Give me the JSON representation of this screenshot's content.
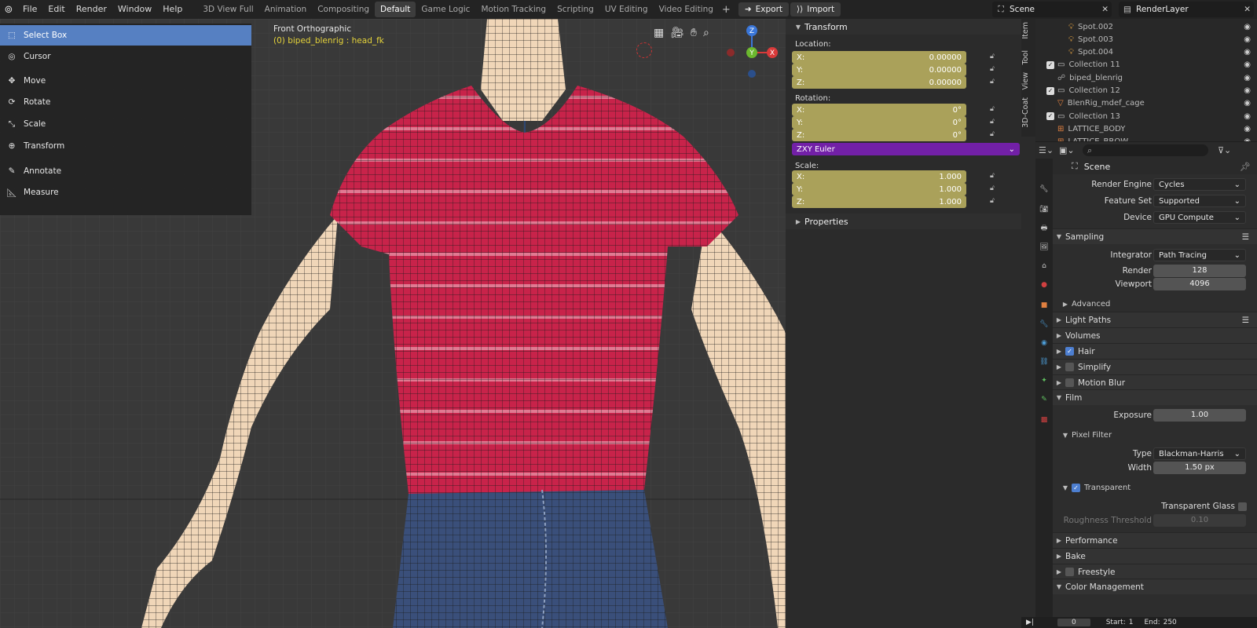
{
  "menu": [
    "File",
    "Edit",
    "Render",
    "Window",
    "Help"
  ],
  "workspaces": [
    "3D View Full",
    "Animation",
    "Compositing",
    "Default",
    "Game Logic",
    "Motion Tracking",
    "Scripting",
    "UV Editing",
    "Video Editing"
  ],
  "active_workspace": "Default",
  "export_label": "Export",
  "import_label": "Import",
  "scene_name": "Scene",
  "render_layer": "RenderLayer",
  "viewport": {
    "title": "Front Orthographic",
    "subtitle": "(0) biped_blenrig : head_fk",
    "tools": [
      {
        "label": "Select Box",
        "icon": "select-box-icon"
      },
      {
        "label": "Cursor",
        "icon": "cursor-icon"
      },
      {
        "label": "Move",
        "icon": "move-icon"
      },
      {
        "label": "Rotate",
        "icon": "rotate-icon"
      },
      {
        "label": "Scale",
        "icon": "scale-icon"
      },
      {
        "label": "Transform",
        "icon": "transform-icon"
      },
      {
        "label": "Annotate",
        "icon": "annotate-icon"
      },
      {
        "label": "Measure",
        "icon": "measure-icon"
      }
    ],
    "gizmo": {
      "z": "Z",
      "y": "Y",
      "x": "X"
    }
  },
  "transform": {
    "header": "Transform",
    "location_label": "Location:",
    "location": [
      {
        "axis": "X:",
        "value": "0.00000"
      },
      {
        "axis": "Y:",
        "value": "0.00000"
      },
      {
        "axis": "Z:",
        "value": "0.00000"
      }
    ],
    "rotation_label": "Rotation:",
    "rotation": [
      {
        "axis": "X:",
        "value": "0°"
      },
      {
        "axis": "Y:",
        "value": "0°"
      },
      {
        "axis": "Z:",
        "value": "0°"
      }
    ],
    "rotation_mode": "ZXY Euler",
    "scale_label": "Scale:",
    "scale": [
      {
        "axis": "X:",
        "value": "1.000"
      },
      {
        "axis": "Y:",
        "value": "1.000"
      },
      {
        "axis": "Z:",
        "value": "1.000"
      }
    ],
    "properties_header": "Properties"
  },
  "side_tabs": [
    "Item",
    "Tool",
    "View",
    "3D-Coat"
  ],
  "outliner": [
    {
      "name": "Spot.002",
      "indent": 3,
      "type": "light"
    },
    {
      "name": "Spot.003",
      "indent": 3,
      "type": "light"
    },
    {
      "name": "Spot.004",
      "indent": 3,
      "type": "light"
    },
    {
      "name": "Collection 11",
      "indent": 1,
      "type": "collection"
    },
    {
      "name": "biped_blenrig",
      "indent": 2,
      "type": "armature"
    },
    {
      "name": "Collection 12",
      "indent": 1,
      "type": "collection"
    },
    {
      "name": "BlenRig_mdef_cage",
      "indent": 2,
      "type": "mesh"
    },
    {
      "name": "Collection 13",
      "indent": 1,
      "type": "collection"
    },
    {
      "name": "LATTICE_BODY",
      "indent": 2,
      "type": "lattice"
    },
    {
      "name": "LATTICE_BROW",
      "indent": 2,
      "type": "lattice"
    }
  ],
  "properties": {
    "context": "Scene",
    "render_engine_label": "Render Engine",
    "render_engine": "Cycles",
    "feature_set_label": "Feature Set",
    "feature_set": "Supported",
    "device_label": "Device",
    "device": "GPU Compute",
    "sampling": "Sampling",
    "integrator_label": "Integrator",
    "integrator": "Path Tracing",
    "render_label": "Render",
    "render_samples": "128",
    "viewport_label": "Viewport",
    "viewport_samples": "4096",
    "advanced": "Advanced",
    "light_paths": "Light Paths",
    "volumes": "Volumes",
    "hair": "Hair",
    "simplify": "Simplify",
    "motion_blur": "Motion Blur",
    "film": "Film",
    "exposure_label": "Exposure",
    "exposure": "1.00",
    "pixel_filter": "Pixel Filter",
    "type_label": "Type",
    "filter_type": "Blackman-Harris",
    "width_label": "Width",
    "filter_width": "1.50 px",
    "transparent": "Transparent",
    "transparent_glass": "Transparent Glass",
    "roughness_threshold_label": "Roughness Threshold",
    "roughness_threshold": "0.10",
    "performance": "Performance",
    "bake": "Bake",
    "freestyle": "Freestyle",
    "color_management": "Color Management"
  },
  "timeline": {
    "frame": "0",
    "start_label": "Start:",
    "start": "1",
    "end_label": "End:",
    "end": "250"
  },
  "colors": {
    "accent": "#5680c2",
    "field_yellow": "#aaa15a",
    "euler_purple": "#7220a7",
    "shirt": "#c8234a",
    "jeans": "#3a4f7a"
  }
}
